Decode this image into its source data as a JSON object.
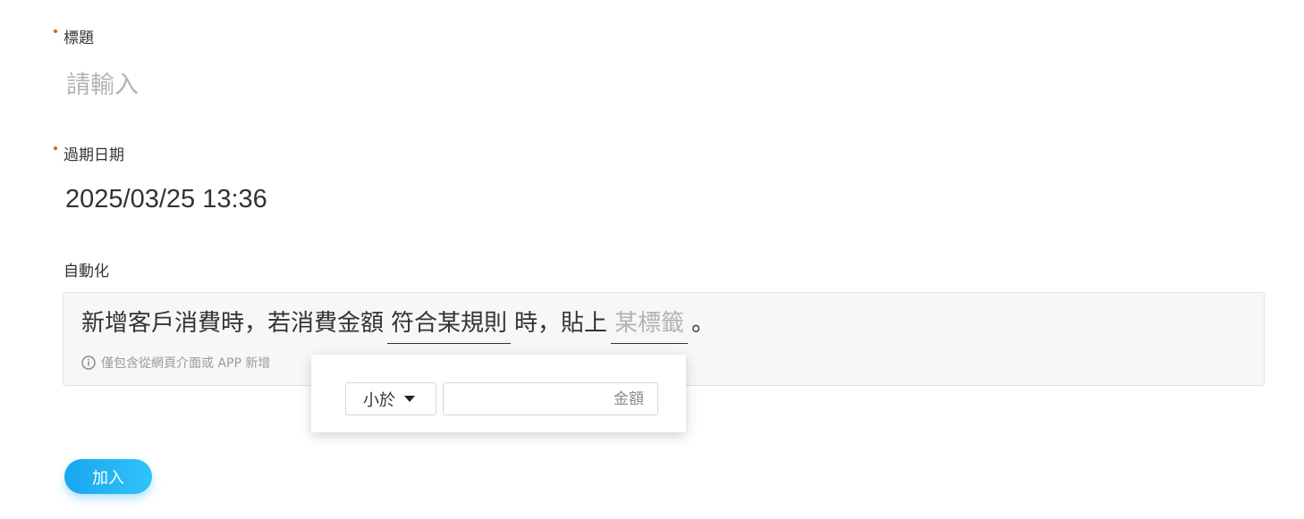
{
  "form": {
    "title": {
      "label": "標題",
      "placeholder": "請輸入",
      "value": ""
    },
    "expiry": {
      "label": "過期日期",
      "value": "2025/03/25 13:36"
    },
    "automation": {
      "label": "自動化",
      "sentence_prefix": "新增客戶消費時，若消費金額",
      "rule_placeholder": "符合某規則",
      "sentence_middle": "時，貼上",
      "tag_placeholder": "某標籤",
      "sentence_end": "。",
      "note": "僅包含從網頁介面或 APP 新增"
    },
    "add_button_label": "加入"
  },
  "popover": {
    "operator_selected": "小於",
    "amount_placeholder": "金額",
    "amount_value": ""
  },
  "colors": {
    "required_dot": "#e8541d",
    "primary_button": "#1fadf2",
    "placeholder_text": "#b3b3b3",
    "note_text": "#9a9a9a"
  }
}
